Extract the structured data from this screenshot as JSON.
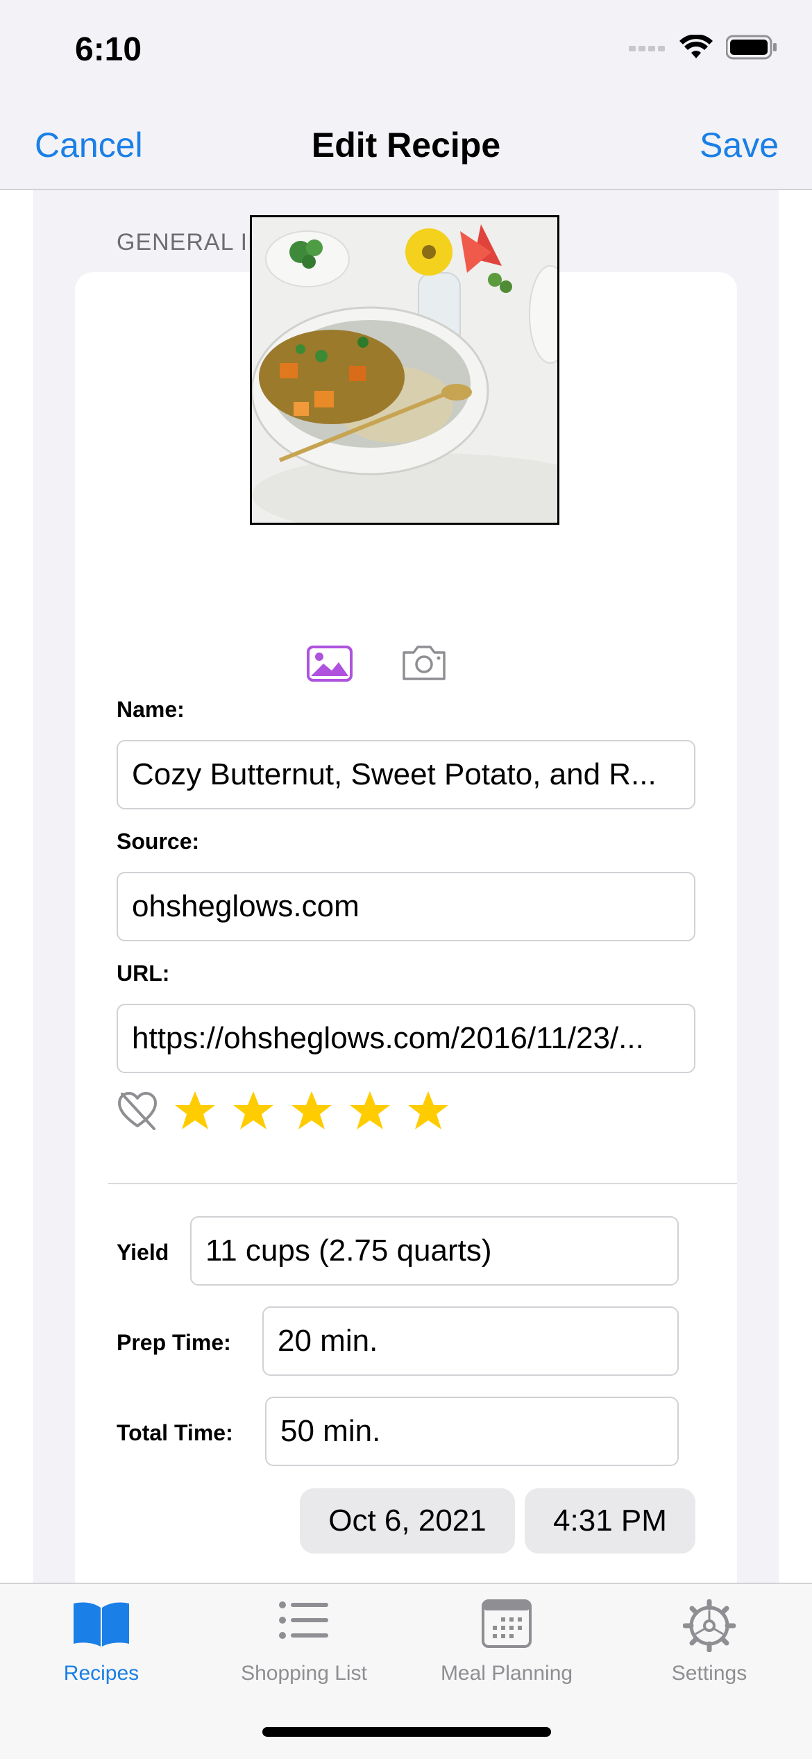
{
  "status": {
    "time": "6:10"
  },
  "nav": {
    "cancel": "Cancel",
    "title": "Edit Recipe",
    "save": "Save"
  },
  "section": {
    "header": "GENERAL INFORMATION"
  },
  "photo": {
    "alt": "Recipe photo: bowl of curry with rice"
  },
  "form": {
    "name_label": "Name:",
    "name_value": "Cozy Butternut, Sweet Potato, and R...",
    "source_label": "Source:",
    "source_value": "ohsheglows.com",
    "url_label": "URL:",
    "url_value": "https://ohsheglows.com/2016/11/23/..."
  },
  "rating": {
    "favorite": false,
    "stars": 5,
    "max_stars": 5,
    "star_color": "#ffcc00"
  },
  "details": {
    "yield_label": "Yield",
    "yield_value": "11 cups (2.75 quarts)",
    "prep_label": "Prep Time:",
    "prep_value": "20 min.",
    "total_label": "Total Time:",
    "total_value": "50 min.",
    "date": "Oct 6, 2021",
    "time": "4:31 PM"
  },
  "tabs": [
    {
      "label": "Recipes",
      "icon": "book-icon",
      "active": true
    },
    {
      "label": "Shopping List",
      "icon": "list-icon",
      "active": false
    },
    {
      "label": "Meal Planning",
      "icon": "calendar-icon",
      "active": false
    },
    {
      "label": "Settings",
      "icon": "gear-icon",
      "active": false
    }
  ],
  "colors": {
    "accent": "#1a7fe6",
    "photo_picker": "#af52de"
  }
}
